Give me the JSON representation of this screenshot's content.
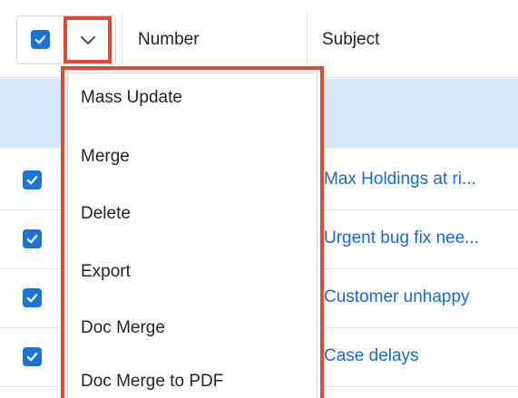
{
  "table": {
    "columns": {
      "number": "Number",
      "subject": "Subject"
    },
    "rows": [
      {
        "subject": "Max Holdings at ri..."
      },
      {
        "subject": "Urgent bug fix nee..."
      },
      {
        "subject": "Customer unhappy"
      },
      {
        "subject": "Case delays"
      }
    ]
  },
  "menu": {
    "items": [
      {
        "label": "Mass Update"
      },
      {
        "label": "Merge"
      },
      {
        "label": "Delete"
      },
      {
        "label": "Export"
      },
      {
        "label": "Doc Merge"
      },
      {
        "label": "Doc Merge to PDF"
      }
    ]
  },
  "colors": {
    "accent": "#1a73d9",
    "link": "#1b69c7",
    "highlight": "#e04b34",
    "selection_band": "#d4e7fb"
  }
}
